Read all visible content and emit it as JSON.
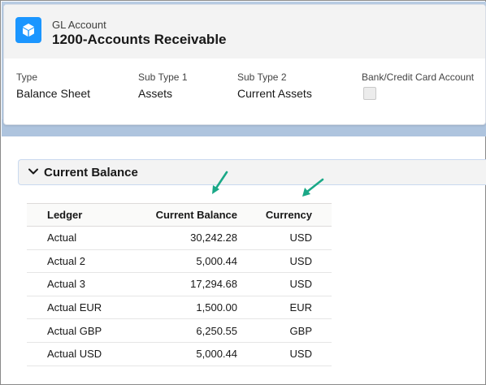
{
  "record": {
    "object_label": "GL Account",
    "title": "1200-Accounts Receivable",
    "icon": "cube-icon",
    "accent_color": "#1b96ff"
  },
  "fields": [
    {
      "label": "Type",
      "value": "Balance Sheet"
    },
    {
      "label": "Sub Type 1",
      "value": "Assets"
    },
    {
      "label": "Sub Type 2",
      "value": "Current Assets"
    },
    {
      "label": "Bank/Credit Card Account",
      "checked": false
    }
  ],
  "section": {
    "title": "Current Balance",
    "icon": "chevron-down-icon"
  },
  "annotation_color": "#1aa887",
  "table": {
    "headers": [
      "Ledger",
      "Current Balance",
      "Currency"
    ],
    "rows": [
      [
        "Actual",
        "30,242.28",
        "USD"
      ],
      [
        "Actual 2",
        "5,000.44",
        "USD"
      ],
      [
        "Actual 3",
        "17,294.68",
        "USD"
      ],
      [
        "Actual EUR",
        "1,500.00",
        "EUR"
      ],
      [
        "Actual GBP",
        "6,250.55",
        "GBP"
      ],
      [
        "Actual USD",
        "5,000.44",
        "USD"
      ]
    ]
  }
}
